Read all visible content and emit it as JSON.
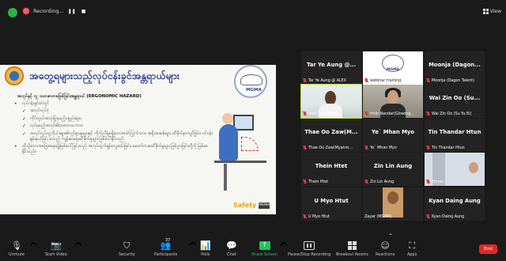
{
  "topbar": {
    "recording_label": "Recording...",
    "view_label": "View"
  },
  "slide": {
    "title": "အတွေ့ရများသည့်လုပ်ငန်းခွင်အန္တရာယ်များ",
    "subtitle": "အလုပ်နှင့် လူ သဟဇာတမဖြစ်ခြင်းအန္တရာယ် (ERGONOMIC HAZARD)",
    "logo_text": "MGMA",
    "items": [
      {
        "level": "main",
        "text": "လုပ်ငန်းခွင်ထဲတွင်"
      },
      {
        "level": "sub",
        "text": "အလုပ်လုပ်ပုံ"
      },
      {
        "level": "sub",
        "text": "ကိုင်တွယ်အသုံးပြုရမည့်ပစ္စည်းများ"
      },
      {
        "level": "sub",
        "text": "လုပ်ရမည့်အလုပ်၏သဘောသဘာဝ"
      },
      {
        "level": "sub",
        "text": "အလုပ်လုပ်သူ့ကိုယ်ခန္ဓာ၏လှုပ်ရှားမှုများနှင့် ကိုက်ညီမှုမရှိသောအခါ ကြွက်သား၊ အရိုးအဆစ်များ ထိခိုက်နာကျင်ခြင်း၊ ပင်ပန်းနွမ်းနယ်ခြင်း စသည့် ကျန်းမာရေးထိခိုက်မှုများ ဖြစ်ပေါ်နိုင်သည်"
      },
      {
        "level": "main",
        "text": "ထိုသို့သောအခြေအနေမျိုးဖြစ်ပေါ်ခြင်းသည် အလုပ်ထွက်နှုန်းကျဆင်းခြင်း၊ မတော်တဆထိခိုက်မှုများ ဖြစ်ပွားခြင်းတို့ကို ဖြစ်စေနိုင်သည်။"
      }
    ],
    "brand": "Safety",
    "brand_badge": "MGMA"
  },
  "participants": [
    {
      "display": "Tar Ye Aung @...",
      "label": "Tar Ye Aung @ ALEX",
      "video": false
    },
    {
      "display": "",
      "label": "webinar training",
      "video": "logo"
    },
    {
      "display": "Moonja (Dagon...",
      "label": "Moonja (Dagon Talent)",
      "video": false
    },
    {
      "display": "",
      "label": "Hein Myo Naung",
      "video": "a",
      "active": true
    },
    {
      "display": "",
      "label": "Hnin Nandar(Glowing...",
      "video": "b"
    },
    {
      "display": "Wai Zin Oo (Su...",
      "label": "Wai Zin Oo (Su Yu Ei)",
      "video": false
    },
    {
      "display": "Thae Oo Zaw(M...",
      "label": "Thae Oo Zaw(Myanm...",
      "video": false
    },
    {
      "display": "Ye` Mhan Myo",
      "label": "Ye` Mhan Myo",
      "video": false
    },
    {
      "display": "Tin Thandar Htun",
      "label": "Tin Thandar Htun",
      "video": false
    },
    {
      "display": "Thein Htet",
      "label": "Thein Htet",
      "video": false
    },
    {
      "display": "Zin Lin Aung",
      "label": "Zin Lin Aung",
      "video": false
    },
    {
      "display": "",
      "label": "Eimon",
      "video": "e"
    },
    {
      "display": "U Myo Htut",
      "label": "U Myo Htut",
      "video": false
    },
    {
      "display": "",
      "label": "Zayar (MGMA)",
      "video": "avatar"
    },
    {
      "display": "Kyan Daing Aung",
      "label": "Kyan Daing Aung",
      "video": false
    }
  ],
  "toolbar": {
    "unmute": "Unmute",
    "start_video": "Start Video",
    "security": "Security",
    "participants": "Participants",
    "participant_count": "37",
    "polls": "Polls",
    "chat": "Chat",
    "share_screen": "Share Screen",
    "pause_recording": "Pause/Stop Recording",
    "breakout_rooms": "Breakout Rooms",
    "reactions": "Reactions",
    "apps": "Apps",
    "end": "End"
  },
  "colors": {
    "accent_green": "#22c55e",
    "end_red": "#e02828",
    "slide_title": "#2b3b8f",
    "recording_red": "#ff5a66"
  }
}
